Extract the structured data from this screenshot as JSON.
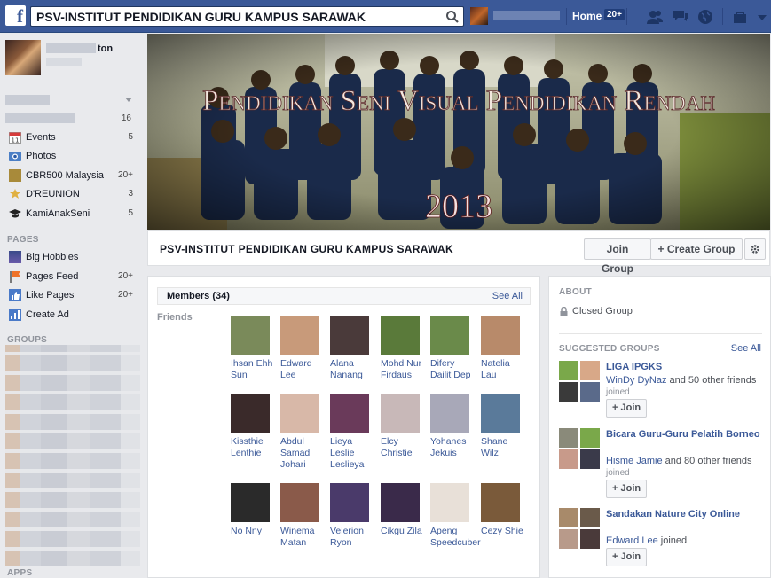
{
  "topbar": {
    "search_value": "PSV-INSTITUT PENDIDIKAN GURU KAMPUS SARAWAK",
    "home_label": "Home",
    "home_count": "20+"
  },
  "leftnav": {
    "profile_name_suffix": "ton",
    "favorites_count": "16",
    "items": [
      {
        "label": "Events",
        "count": "5"
      },
      {
        "label": "Photos",
        "count": ""
      },
      {
        "label": "CBR500 Malaysia",
        "count": "20+"
      },
      {
        "label": "D'REUNION",
        "count": "3"
      },
      {
        "label": "KamiAnakSeni",
        "count": "5"
      }
    ],
    "pages_header": "PAGES",
    "pages": [
      {
        "label": "Big Hobbies",
        "count": ""
      },
      {
        "label": "Pages Feed",
        "count": "20+"
      },
      {
        "label": "Like Pages",
        "count": "20+"
      },
      {
        "label": "Create Ad",
        "count": ""
      }
    ],
    "groups_header": "GROUPS",
    "apps_header": "APPS"
  },
  "cover": {
    "title": "Pendidikan Seni Visual Pendidikan Rendah",
    "year": "2013"
  },
  "group": {
    "name": "PSV-INSTITUT PENDIDIKAN GURU KAMPUS SARAWAK",
    "join_label": "Join Group",
    "create_label": "+ Create Group",
    "settings_icon": "gear-icon"
  },
  "members": {
    "title": "Members (34)",
    "see_all": "See All",
    "friends_label": "Friends",
    "rows": [
      [
        {
          "name": "Ihsan Ehh Sun",
          "color": "#7a8a5a"
        },
        {
          "name": "Edward Lee",
          "color": "#c89a7a"
        },
        {
          "name": "Alana Nanang",
          "color": "#4a3a3a"
        },
        {
          "name": "Mohd Nur Firdaus",
          "color": "#5a7a3a"
        },
        {
          "name": "Difery Dailit Dep",
          "color": "#6a8a4a"
        },
        {
          "name": "Natelia Lau",
          "color": "#b88a6a"
        }
      ],
      [
        {
          "name": "Kissthie Lenthie",
          "color": "#3a2a2a"
        },
        {
          "name": "Abdul Samad Johari",
          "color": "#d8b8a8"
        },
        {
          "name": "Lieya Leslie Leslieya",
          "color": "#6a3a5a"
        },
        {
          "name": "Elcy Christie",
          "color": "#c8b8b8"
        },
        {
          "name": "Yohanes Jekuis",
          "color": "#a8a8b8"
        },
        {
          "name": "Shane Wilz",
          "color": "#5a7a9a"
        }
      ],
      [
        {
          "name": "No Nny",
          "color": "#2a2a2a"
        },
        {
          "name": "Winema Matan",
          "color": "#8a5a4a"
        },
        {
          "name": "Velerion Ryon",
          "color": "#4a3a6a"
        },
        {
          "name": "Cikgu Zila",
          "color": "#3a2a4a"
        },
        {
          "name": "Apeng Speedcuber",
          "color": "#e8e0d8"
        },
        {
          "name": "Cezy Shie",
          "color": "#7a5a3a"
        }
      ]
    ]
  },
  "about": {
    "title": "ABOUT",
    "privacy": "Closed Group",
    "suggested_title": "SUGGESTED GROUPS",
    "see_all": "See All",
    "join_label": "+ Join",
    "joined_label": "joined",
    "groups": [
      {
        "name": "LIGA IPGKS",
        "member_link": "WinDy DyNaz",
        "meta_rest": " and 50 other friends"
      },
      {
        "name": "Bicara Guru-Guru Pelatih Borneo",
        "member_link": "Hisme Jamie",
        "meta_rest": " and 80 other friends"
      },
      {
        "name": "Sandakan Nature City Online",
        "member_link": "Edward Lee",
        "meta_rest": " joined"
      }
    ]
  }
}
